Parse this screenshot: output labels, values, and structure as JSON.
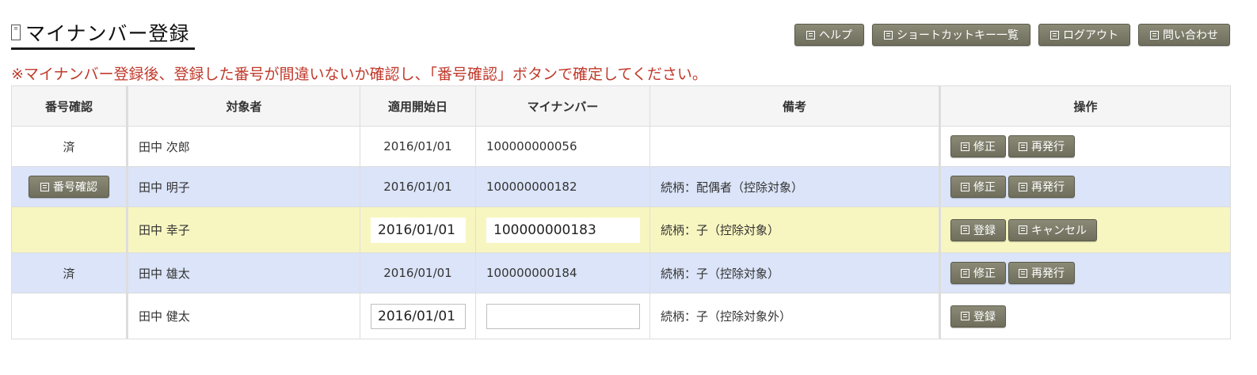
{
  "header": {
    "title_icon": "page-icon",
    "title": "マイナンバー登録",
    "buttons": [
      {
        "label": "ヘルプ",
        "icon": "doc-icon"
      },
      {
        "label": "ショートカットキー一覧",
        "icon": "doc-icon"
      },
      {
        "label": "ログアウト",
        "icon": "doc-icon"
      },
      {
        "label": "問い合わせ",
        "icon": "doc-icon"
      }
    ]
  },
  "notice": "※マイナンバー登録後、登録した番号が間違いないか確認し、「番号確認」ボタンで確定してください。",
  "table": {
    "columns": [
      "番号確認",
      "対象者",
      "適用開始日",
      "マイナンバー",
      "備考",
      "操作"
    ],
    "rows": [
      {
        "check": "済",
        "name": "田中 次郎",
        "date": "2016/01/01",
        "number": "100000000056",
        "note": "",
        "actions": [
          "修正",
          "再発行"
        ]
      },
      {
        "check_button": "番号確認",
        "name": "田中 明子",
        "date": "2016/01/01",
        "number": "100000000182",
        "note": "続柄：配偶者（控除対象）",
        "actions": [
          "修正",
          "再発行"
        ]
      },
      {
        "check": "",
        "name": "田中 幸子",
        "date_input": "2016/01/01",
        "number_input": "100000000183",
        "note": "続柄：子（控除対象）",
        "actions": [
          "登録",
          "キャンセル"
        ]
      },
      {
        "check": "済",
        "name": "田中 雄太",
        "date": "2016/01/01",
        "number": "100000000184",
        "note": "続柄：子（控除対象）",
        "actions": [
          "修正",
          "再発行"
        ]
      },
      {
        "check": "",
        "name": "田中 健太",
        "date_input": "2016/01/01",
        "number_input": "",
        "note": "続柄：子（控除対象外）",
        "actions": [
          "登録"
        ]
      }
    ]
  },
  "colors": {
    "notice": "#c0392b",
    "row_blue": "#dbe4f8",
    "row_yellow": "#f8f6c0",
    "button": "#7a7966"
  }
}
